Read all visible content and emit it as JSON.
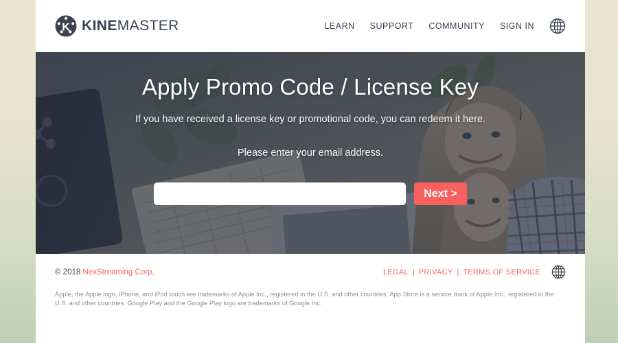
{
  "header": {
    "logo": {
      "icon": "kinemaster-logo-icon",
      "name_bold": "KINE",
      "name_light": "MASTER"
    },
    "nav": [
      {
        "label": "LEARN"
      },
      {
        "label": "SUPPORT"
      },
      {
        "label": "COMMUNITY"
      },
      {
        "label": "SIGN IN"
      }
    ],
    "language_icon": "globe-icon"
  },
  "hero": {
    "title": "Apply Promo Code / License Key",
    "subtitle": "If you have received a license key or promotional code, you can redeem it here.",
    "prompt": "Please enter your email address.",
    "email_value": "",
    "email_placeholder": "",
    "next_label": "Next >"
  },
  "footer": {
    "copyright_prefix": "© 2018 ",
    "company_link": "NexStreaming Corp",
    "copyright_suffix": ".",
    "links": [
      {
        "label": "LEGAL"
      },
      {
        "label": "PRIVACY"
      },
      {
        "label": "TERMS OF SERVICE"
      }
    ],
    "separator": "|",
    "language_icon": "globe-icon",
    "legal_text": "Apple, the Apple logo, iPhone, and iPod touch are trademarks of Apple Inc., registered in the U.S. and other countries. App Store is a service mark of Apple Inc., registered in the U.S. and other countries. Google Play and the Google Play logo are trademarks of Google Inc."
  },
  "colors": {
    "accent": "#f9615e",
    "dark_text": "#3b4250",
    "hero_overlay": "#2b303c"
  }
}
